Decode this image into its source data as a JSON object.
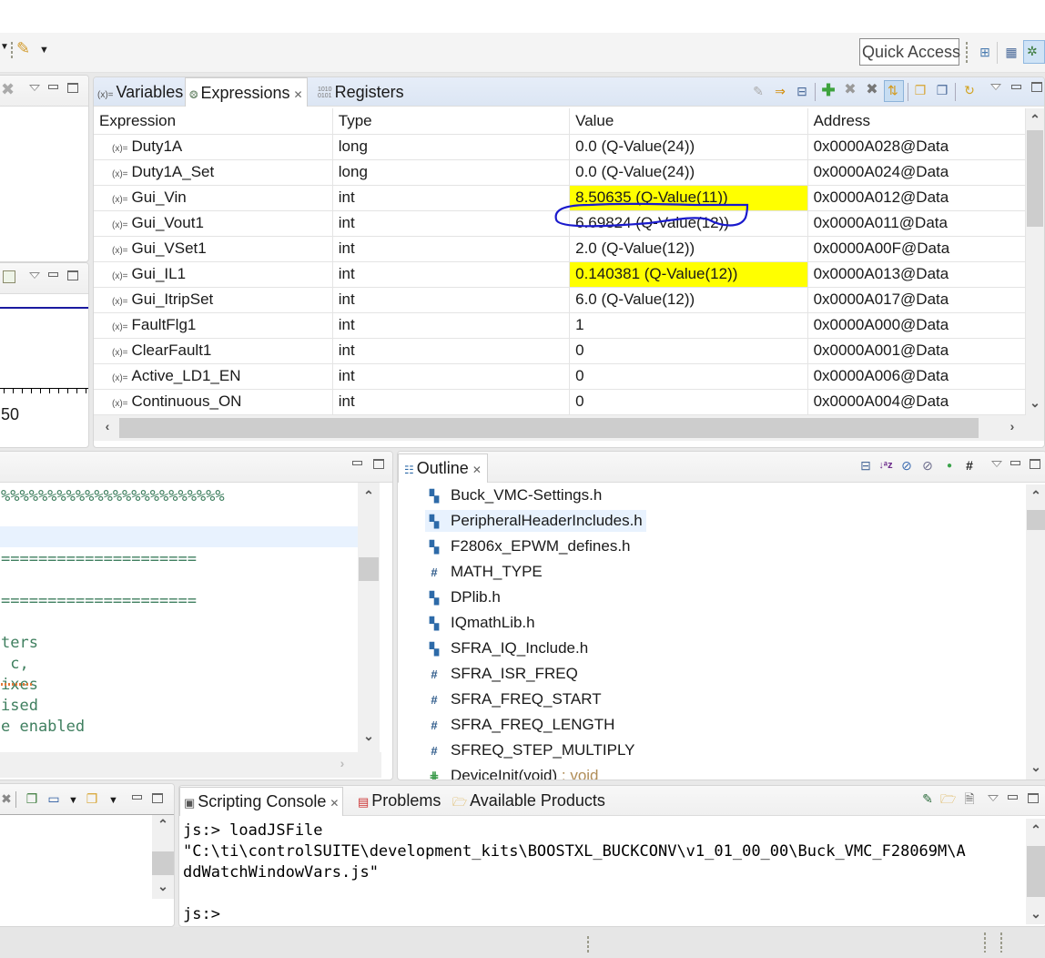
{
  "toolbar": {
    "quick_access": "Quick Access"
  },
  "expressions_view": {
    "tabs": [
      {
        "label": "Variables",
        "icon": "variables-icon"
      },
      {
        "label": "Expressions",
        "icon": "expressions-icon",
        "active": true
      },
      {
        "label": "Registers",
        "icon": "registers-icon"
      }
    ],
    "columns": [
      "Expression",
      "Type",
      "Value",
      "Address"
    ],
    "rows": [
      {
        "name": "Duty1A",
        "type": "long",
        "value": "0.0 (Q-Value(24))",
        "address": "0x0000A028@Data",
        "highlight": false
      },
      {
        "name": "Duty1A_Set",
        "type": "long",
        "value": "0.0 (Q-Value(24))",
        "address": "0x0000A024@Data",
        "highlight": false
      },
      {
        "name": "Gui_Vin",
        "type": "int",
        "value": "8.50635 (Q-Value(11))",
        "address": "0x0000A012@Data",
        "highlight": true
      },
      {
        "name": "Gui_Vout1",
        "type": "int",
        "value": "6.69824 (Q-Value(12))",
        "address": "0x0000A011@Data",
        "highlight": false,
        "circled": true
      },
      {
        "name": "Gui_VSet1",
        "type": "int",
        "value": "2.0 (Q-Value(12))",
        "address": "0x0000A00F@Data",
        "highlight": false
      },
      {
        "name": "Gui_IL1",
        "type": "int",
        "value": "0.140381 (Q-Value(12))",
        "address": "0x0000A013@Data",
        "highlight": true
      },
      {
        "name": "Gui_ItripSet",
        "type": "int",
        "value": "6.0 (Q-Value(12))",
        "address": "0x0000A017@Data",
        "highlight": false
      },
      {
        "name": "FaultFlg1",
        "type": "int",
        "value": "1",
        "address": "0x0000A000@Data",
        "highlight": false
      },
      {
        "name": "ClearFault1",
        "type": "int",
        "value": "0",
        "address": "0x0000A001@Data",
        "highlight": false
      },
      {
        "name": "Active_LD1_EN",
        "type": "int",
        "value": "0",
        "address": "0x0000A006@Data",
        "highlight": false
      },
      {
        "name": "Continuous_ON",
        "type": "int",
        "value": "0",
        "address": "0x0000A004@Data",
        "highlight": false
      }
    ],
    "highlight_color": "#ffff00",
    "annotation_color": "#1a1acc"
  },
  "graph_panel": {
    "axis_tick_label": "50"
  },
  "editor": {
    "lines": [
      "%%%%%%%%%%%%%%%%%%%%%%%%",
      "",
      "",
      "=====================",
      "",
      "=====================",
      "",
      "ters",
      " c,",
      "ixes",
      "ised",
      "e enabled"
    ]
  },
  "outline": {
    "title": "Outline",
    "items": [
      {
        "label": "Buck_VMC-Settings.h",
        "kind": "include"
      },
      {
        "label": "PeripheralHeaderIncludes.h",
        "kind": "include",
        "selected": true
      },
      {
        "label": "F2806x_EPWM_defines.h",
        "kind": "include"
      },
      {
        "label": "MATH_TYPE",
        "kind": "macro"
      },
      {
        "label": "DPlib.h",
        "kind": "include"
      },
      {
        "label": "IQmathLib.h",
        "kind": "include"
      },
      {
        "label": "SFRA_IQ_Include.h",
        "kind": "include"
      },
      {
        "label": "SFRA_ISR_FREQ",
        "kind": "macro"
      },
      {
        "label": "SFRA_FREQ_START",
        "kind": "macro"
      },
      {
        "label": "SFRA_FREQ_LENGTH",
        "kind": "macro"
      },
      {
        "label": "SFREQ_STEP_MULTIPLY",
        "kind": "macro"
      },
      {
        "label": "DeviceInit(void)",
        "kind": "function",
        "suffix": " : void"
      }
    ]
  },
  "console": {
    "tabs": [
      {
        "label": "Scripting Console",
        "active": true
      },
      {
        "label": "Problems"
      },
      {
        "label": "Available Products"
      }
    ],
    "lines": [
      "js:> loadJSFile",
      "\"C:\\ti\\controlSUITE\\development_kits\\BOOSTXL_BUCKCONV\\v1_01_00_00\\Buck_VMC_F28069M\\A",
      "ddWatchWindowVars.js\"",
      "",
      "js:>"
    ]
  }
}
